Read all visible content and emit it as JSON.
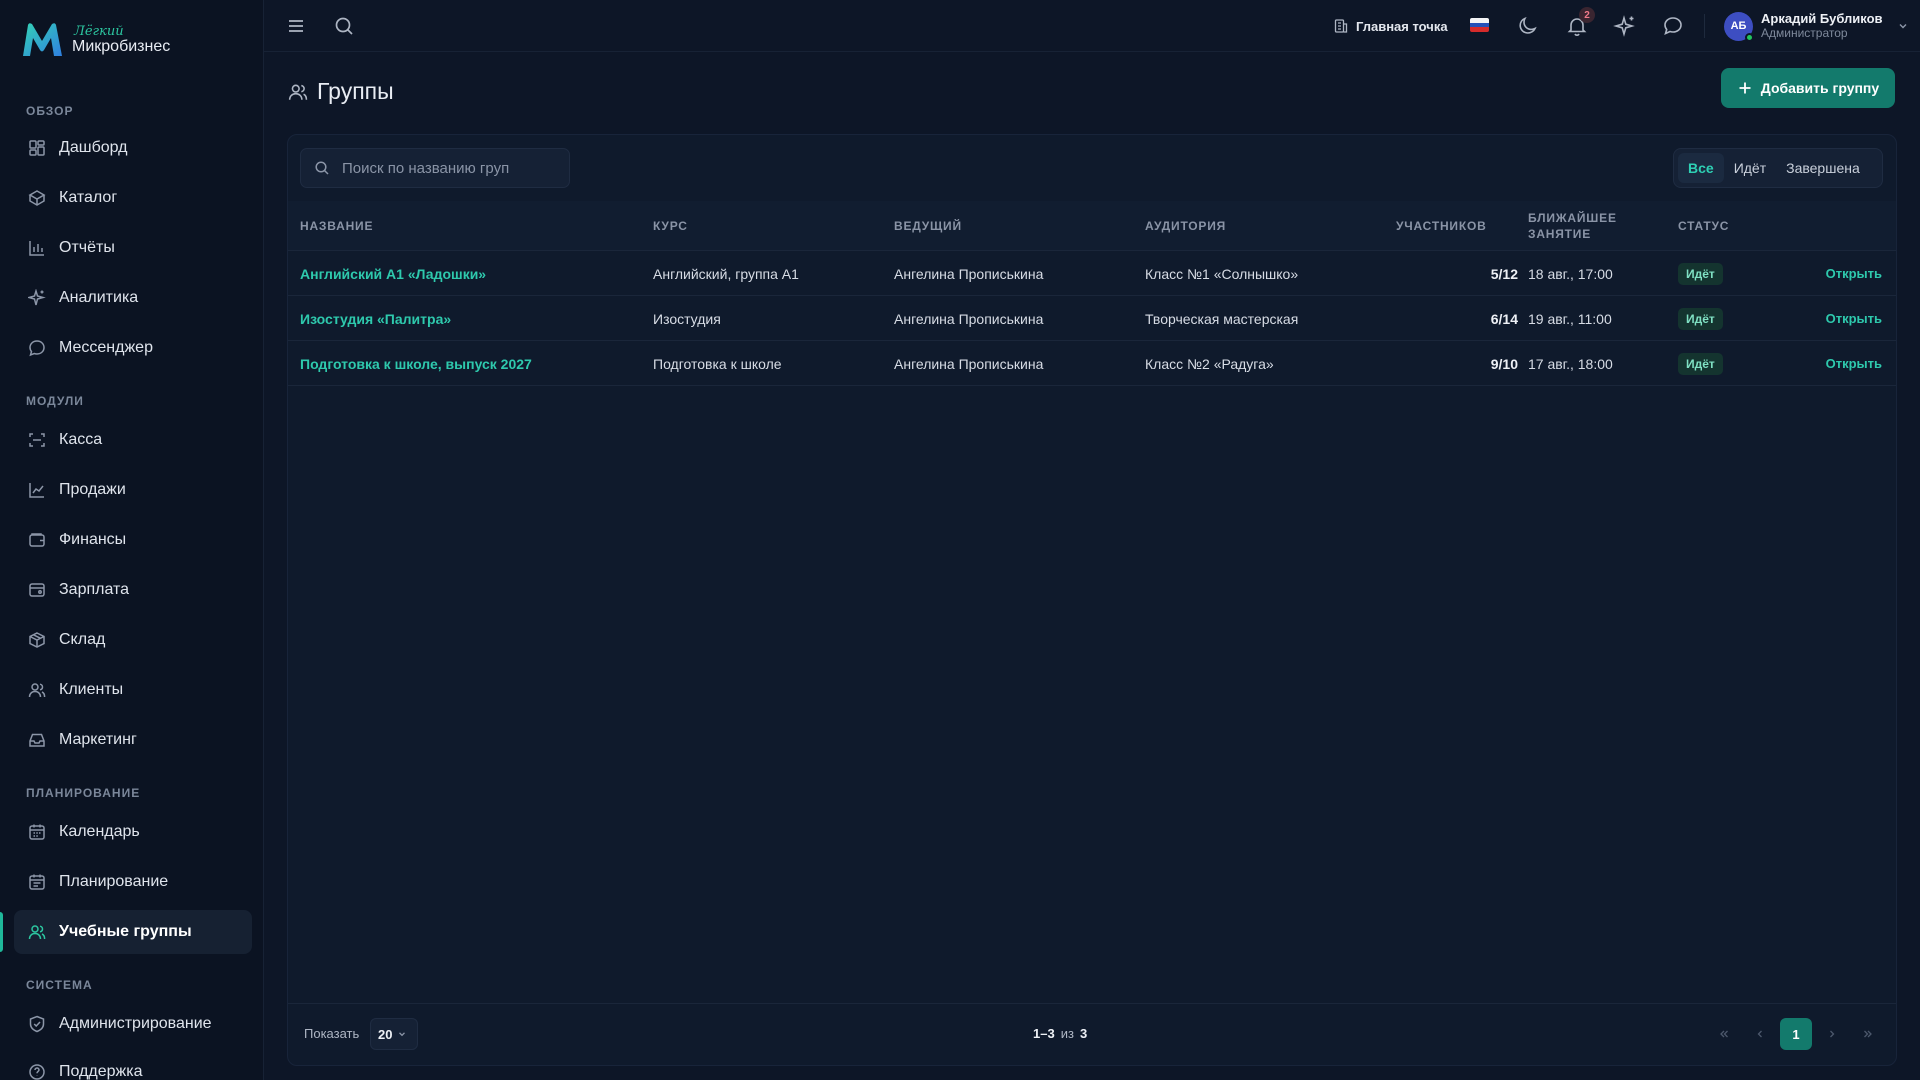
{
  "brand": {
    "small": "Лёгкий",
    "big": "Микробизнес",
    "colors": {
      "accent": "#2cc6a0",
      "primary_button": "#137a6c"
    }
  },
  "sidebar": {
    "sections": [
      {
        "title": "Обзор",
        "items": [
          {
            "label": "Дашборд",
            "icon": "dashboard-icon"
          },
          {
            "label": "Каталог",
            "icon": "catalog-icon"
          },
          {
            "label": "Отчёты",
            "icon": "reports-icon"
          },
          {
            "label": "Аналитика",
            "icon": "sparkle-icon"
          },
          {
            "label": "Мессенджер",
            "icon": "chat-icon"
          }
        ]
      },
      {
        "title": "Модули",
        "items": [
          {
            "label": "Касса",
            "icon": "scan-icon"
          },
          {
            "label": "Продажи",
            "icon": "trend-icon"
          },
          {
            "label": "Финансы",
            "icon": "wallet-icon"
          },
          {
            "label": "Зарплата",
            "icon": "salary-icon"
          },
          {
            "label": "Склад",
            "icon": "box-icon"
          },
          {
            "label": "Клиенты",
            "icon": "users-icon"
          },
          {
            "label": "Маркетинг",
            "icon": "inbox-icon"
          }
        ]
      },
      {
        "title": "Планирование",
        "items": [
          {
            "label": "Календарь",
            "icon": "calendar-icon"
          },
          {
            "label": "Планирование",
            "icon": "calendar-icon"
          },
          {
            "label": "Учебные группы",
            "icon": "users-icon",
            "active": true
          }
        ]
      },
      {
        "title": "Система",
        "items": [
          {
            "label": "Администрирование",
            "icon": "shield-icon"
          },
          {
            "label": "Поддержка",
            "icon": "help-icon"
          }
        ]
      }
    ]
  },
  "topbar": {
    "location": "Главная точка",
    "notifications_count": "2",
    "user": {
      "initials": "АБ",
      "name": "Аркадий Бубликов",
      "role": "Администратор"
    }
  },
  "page": {
    "title": "Группы",
    "add_button": "Добавить группу"
  },
  "search": {
    "placeholder": "Поиск по названию груп"
  },
  "filters": [
    {
      "label": "Все",
      "active": true
    },
    {
      "label": "Идёт"
    },
    {
      "label": "Завершена"
    }
  ],
  "table": {
    "columns": {
      "name": "НАЗВАНИЕ",
      "course": "КУРС",
      "teacher": "ВЕДУЩИЙ",
      "room": "АУДИТОРИЯ",
      "participants": "УЧАСТНИКОВ",
      "next_line1": "БЛИЖАЙШЕЕ",
      "next_line2": "ЗАНЯТИЕ",
      "status": "СТАТУС"
    },
    "rows": [
      {
        "name": "Английский А1 «Ладошки»",
        "course": "Английский, группа А1",
        "teacher": "Ангелина Прописькина",
        "room": "Класс №1 «Солнышко»",
        "participants": "5/12",
        "next": "18 авг., 17:00",
        "status": "Идёт",
        "action": "Открыть"
      },
      {
        "name": "Изостудия «Палитра»",
        "course": "Изостудия",
        "teacher": "Ангелина Прописькина",
        "room": "Творческая мастерская",
        "participants": "6/14",
        "next": "19 авг., 11:00",
        "status": "Идёт",
        "action": "Открыть"
      },
      {
        "name": "Подготовка к школе, выпуск 2027",
        "course": "Подготовка к школе",
        "teacher": "Ангелина Прописькина",
        "room": "Класс №2 «Радуга»",
        "participants": "9/10",
        "next": "17 авг., 18:00",
        "status": "Идёт",
        "action": "Открыть"
      }
    ]
  },
  "footer": {
    "show_label": "Показать",
    "page_size": "20",
    "range": "1–3",
    "of": "из",
    "total": "3",
    "current_page": "1"
  }
}
